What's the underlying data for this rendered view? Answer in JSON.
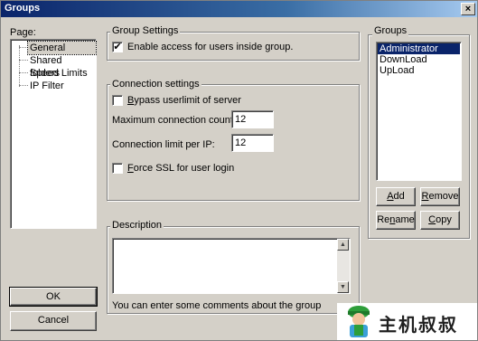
{
  "window": {
    "title": "Groups",
    "close_glyph": "×"
  },
  "page_panel": {
    "label": "Page:",
    "items": [
      "General",
      "Shared folders",
      "Speed Limits",
      "IP Filter"
    ],
    "selected": "General"
  },
  "group_settings": {
    "title": "Group Settings",
    "enable_access_label": "Enable access for users inside group.",
    "enable_access_checked": true
  },
  "connection_settings": {
    "title": "Connection settings",
    "bypass_label": "Bypass userlimit of server",
    "bypass_checked": false,
    "max_conn_label": "Maximum connection count:",
    "max_conn_value": "12",
    "limit_per_ip_label": "Connection limit per IP:",
    "limit_per_ip_value": "12",
    "force_ssl_label": "Force SSL for user login",
    "force_ssl_checked": false
  },
  "description": {
    "title": "Description",
    "value": "",
    "hint": "You can enter some comments about the group"
  },
  "groups_panel": {
    "title": "Groups",
    "items": [
      "Administrator",
      "DownLoad",
      "UpLoad"
    ],
    "selected": "Administrator",
    "add_label": "Add",
    "remove_label": "Remove",
    "rename_label": "Rename",
    "copy_label": "Copy"
  },
  "footer": {
    "ok_label": "OK",
    "cancel_label": "Cancel"
  },
  "watermark": {
    "text": "主机叔叔"
  },
  "colors": {
    "selection": "#0a246a",
    "title_gradient_start": "#0a246a"
  }
}
